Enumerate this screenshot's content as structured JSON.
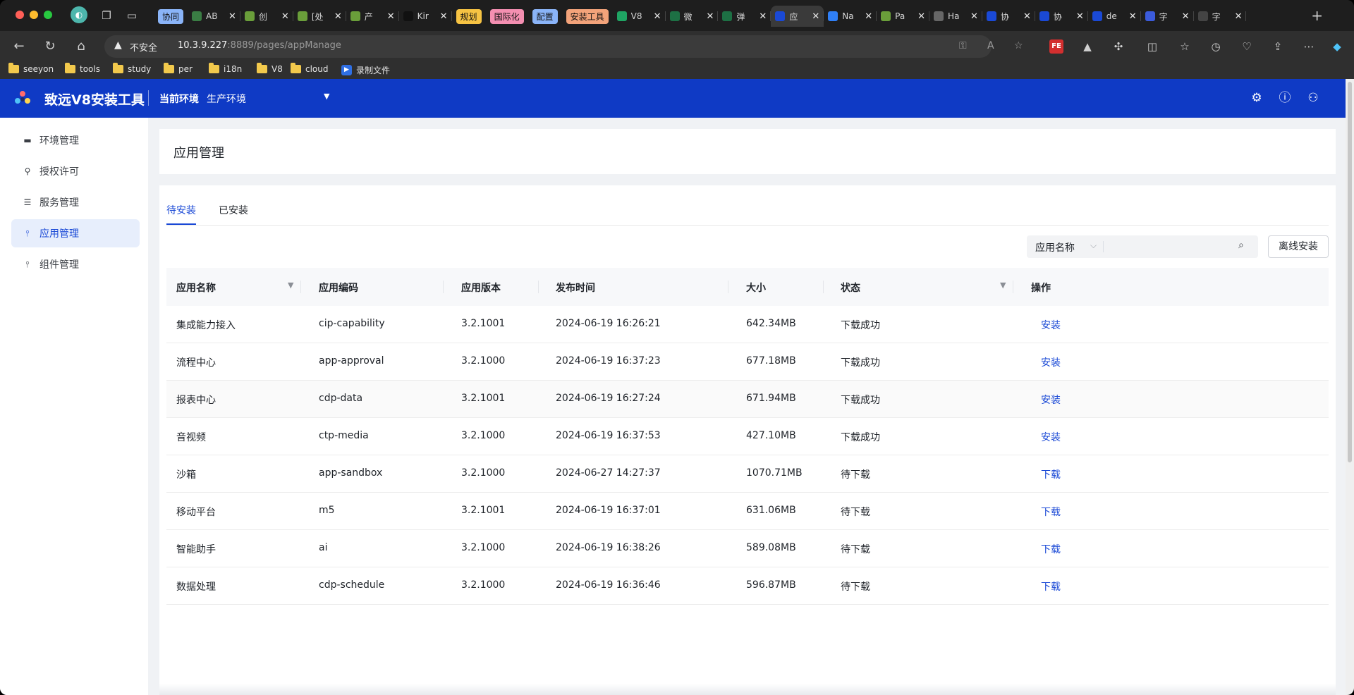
{
  "browser": {
    "tab_groups": [
      {
        "label": "协同",
        "color": "#8ab4f8"
      },
      {
        "label": "规划",
        "color": "#f6c343"
      },
      {
        "label": "国际化",
        "color": "#f48fb1"
      },
      {
        "label": "配置",
        "color": "#8ab4f8"
      },
      {
        "label": "安装工具",
        "color": "#f3a37a"
      }
    ],
    "tabs": [
      {
        "title": "AB",
        "fav": "#3a7d44"
      },
      {
        "title": "创",
        "fav": "#6a9e3a"
      },
      {
        "title": "[处",
        "fav": "#6a9e3a"
      },
      {
        "title": "产",
        "fav": "#6a9e3a"
      },
      {
        "title": "Kir",
        "fav": "#111111"
      },
      {
        "title": "V8",
        "fav": "#1fa463"
      },
      {
        "title": "微",
        "fav": "#1d7044"
      },
      {
        "title": "弹",
        "fav": "#1d7044"
      },
      {
        "title": "应",
        "fav": "#1a49d6"
      },
      {
        "title": "Na",
        "fav": "#2f7ff6"
      },
      {
        "title": "Pa",
        "fav": "#6a9e3a"
      },
      {
        "title": "Ha",
        "fav": "#666666"
      },
      {
        "title": "协",
        "fav": "#1a49d6"
      },
      {
        "title": "协",
        "fav": "#1a49d6"
      },
      {
        "title": "de",
        "fav": "#1a49d6"
      },
      {
        "title": "字",
        "fav": "#3b5bdb"
      },
      {
        "title": "字",
        "fav": "#444444"
      }
    ],
    "address": {
      "security": "不安全",
      "host": "10.3.9.227",
      "rest": ":8889/pages/appManage"
    },
    "bookmarks": [
      {
        "label": "seeyon",
        "type": "folder"
      },
      {
        "label": "tools",
        "type": "folder"
      },
      {
        "label": "study",
        "type": "folder"
      },
      {
        "label": "per",
        "type": "folder"
      },
      {
        "label": "i18n",
        "type": "folder"
      },
      {
        "label": "V8",
        "type": "folder"
      },
      {
        "label": "cloud",
        "type": "folder"
      },
      {
        "label": "录制文件",
        "type": "link"
      }
    ]
  },
  "app": {
    "title": "致远V8安装工具",
    "env_label": "当前环境",
    "env_value": "生产环境",
    "brand_color": "#0f3ac5",
    "accent_color": "#1a49d6"
  },
  "sidebar": {
    "items": [
      {
        "label": "环境管理",
        "icon": "server-icon",
        "active": false
      },
      {
        "label": "授权许可",
        "icon": "key-icon",
        "active": false
      },
      {
        "label": "服务管理",
        "icon": "service-icon",
        "active": false
      },
      {
        "label": "应用管理",
        "icon": "app-icon",
        "active": true
      },
      {
        "label": "组件管理",
        "icon": "component-icon",
        "active": false
      }
    ]
  },
  "main": {
    "page_title": "应用管理",
    "tabs": [
      {
        "label": "待安装",
        "active": true
      },
      {
        "label": "已安装",
        "active": false
      }
    ],
    "search": {
      "field_selected": "应用名称",
      "placeholder": "",
      "value": ""
    },
    "offline_install_label": "离线安装",
    "table": {
      "columns": [
        "应用名称",
        "应用编码",
        "应用版本",
        "发布时间",
        "大小",
        "状态",
        "操作"
      ],
      "rows": [
        {
          "name": "集成能力接入",
          "code": "cip-capability",
          "version": "3.2.1001",
          "time": "2024-06-19 16:26:21",
          "size": "642.34MB",
          "status": "下载成功",
          "action": "安装"
        },
        {
          "name": "流程中心",
          "code": "app-approval",
          "version": "3.2.1000",
          "time": "2024-06-19 16:37:23",
          "size": "677.18MB",
          "status": "下载成功",
          "action": "安装"
        },
        {
          "name": "报表中心",
          "code": "cdp-data",
          "version": "3.2.1001",
          "time": "2024-06-19 16:27:24",
          "size": "671.94MB",
          "status": "下载成功",
          "action": "安装"
        },
        {
          "name": "音视频",
          "code": "ctp-media",
          "version": "3.2.1000",
          "time": "2024-06-19 16:37:53",
          "size": "427.10MB",
          "status": "下载成功",
          "action": "安装"
        },
        {
          "name": "沙箱",
          "code": "app-sandbox",
          "version": "3.2.1000",
          "time": "2024-06-27 14:27:37",
          "size": "1070.71MB",
          "status": "待下载",
          "action": "下载"
        },
        {
          "name": "移动平台",
          "code": "m5",
          "version": "3.2.1001",
          "time": "2024-06-19 16:37:01",
          "size": "631.06MB",
          "status": "待下载",
          "action": "下载"
        },
        {
          "name": "智能助手",
          "code": "ai",
          "version": "3.2.1000",
          "time": "2024-06-19 16:38:26",
          "size": "589.08MB",
          "status": "待下载",
          "action": "下载"
        },
        {
          "name": "数据处理",
          "code": "cdp-schedule",
          "version": "3.2.1000",
          "time": "2024-06-19 16:36:46",
          "size": "596.87MB",
          "status": "待下载",
          "action": "下载"
        }
      ]
    }
  }
}
